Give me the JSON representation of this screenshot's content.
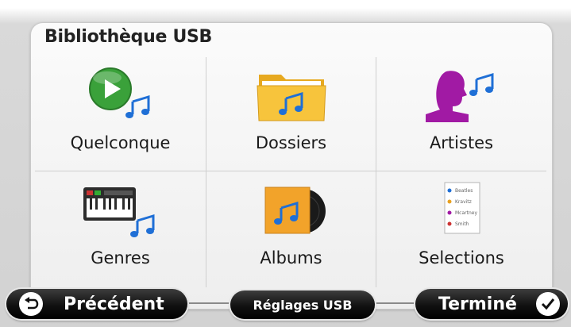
{
  "library": {
    "title": "Bibliothèque USB",
    "items": [
      {
        "label": "Quelconque",
        "icon": "play-music-icon"
      },
      {
        "label": "Dossiers",
        "icon": "music-folder-icon"
      },
      {
        "label": "Artistes",
        "icon": "artist-music-icon"
      },
      {
        "label": "Genres",
        "icon": "keyboard-music-icon"
      },
      {
        "label": "Albums",
        "icon": "album-icon"
      },
      {
        "label": "Selections",
        "icon": "playlist-icon"
      }
    ],
    "playlist_entries": [
      "Beatles",
      "Kravitz",
      "Mcartney",
      "Smith"
    ]
  },
  "footer": {
    "back_label": "Précédent",
    "settings_label": "Réglages USB",
    "done_label": "Terminé"
  },
  "colors": {
    "note_blue": "#1f6fd6",
    "play_green": "#3aa13a",
    "folder_yellow": "#f7c43c",
    "artist_purple": "#a11aa4"
  }
}
